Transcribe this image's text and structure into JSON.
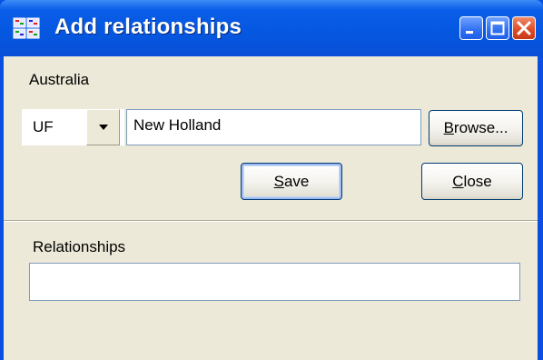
{
  "window": {
    "title": "Add relationships",
    "icon": "app-grid-icon",
    "controls": [
      "minimize-icon",
      "maximize-icon",
      "close-icon"
    ]
  },
  "form": {
    "country_label": "Australia",
    "type_select": {
      "value": "UF"
    },
    "name_input": {
      "value": "New Holland"
    },
    "browse_button": {
      "mnemonic": "B",
      "rest": "rowse..."
    },
    "save_button": {
      "mnemonic": "S",
      "rest": "ave"
    },
    "close_button": {
      "mnemonic": "C",
      "rest": "lose"
    }
  },
  "relationships": {
    "label": "Relationships",
    "value": ""
  },
  "colors": {
    "titlebar": "#0557e0",
    "client": "#ece9d8",
    "input_border": "#7f9db9",
    "button_border": "#003c74"
  }
}
